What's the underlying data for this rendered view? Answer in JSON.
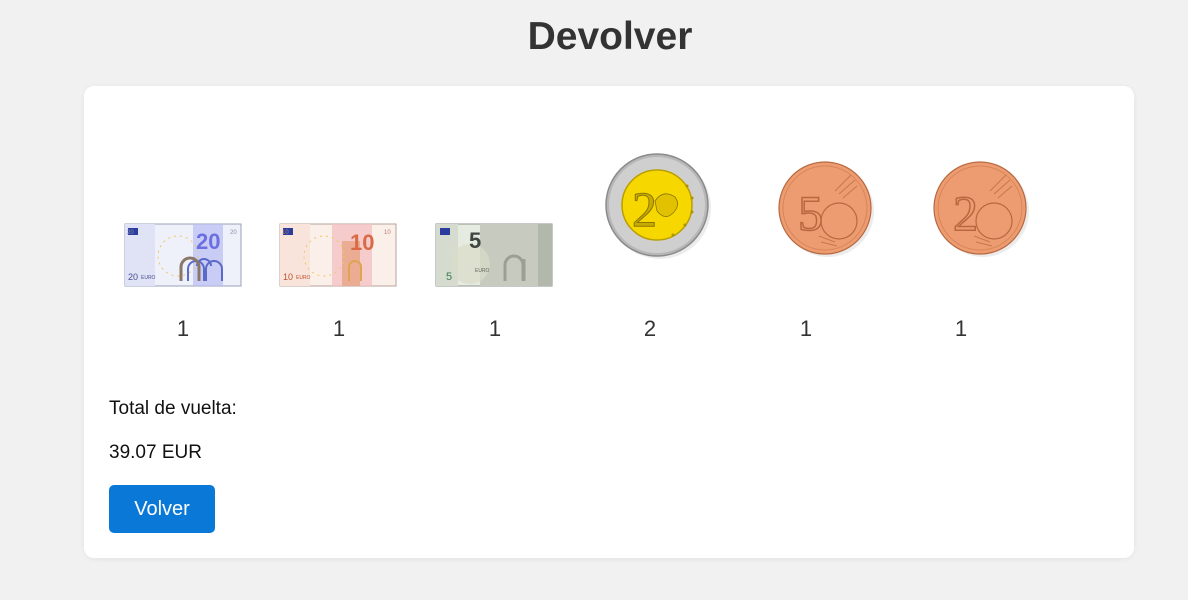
{
  "page": {
    "title": "Devolver"
  },
  "change": {
    "items": [
      {
        "kind": "banknote",
        "denomination": "20",
        "currency_label": "EURO",
        "count": "1",
        "icon": "20-euro-banknote-icon",
        "color": "#7d7fe8"
      },
      {
        "kind": "banknote",
        "denomination": "10",
        "currency_label": "EURO",
        "count": "1",
        "icon": "10-euro-banknote-icon",
        "color": "#e0704c"
      },
      {
        "kind": "banknote",
        "denomination": "5",
        "currency_label": "EURO",
        "count": "1",
        "icon": "5-euro-banknote-icon",
        "color": "#8a9a8c"
      },
      {
        "kind": "coin",
        "denomination": "2",
        "count": "2",
        "icon": "2-euro-coin-icon",
        "color": "#f5d400"
      },
      {
        "kind": "coin",
        "denomination": "5",
        "count": "1",
        "icon": "5-cent-coin-icon",
        "color": "#e9976a"
      },
      {
        "kind": "coin",
        "denomination": "2",
        "count": "1",
        "icon": "2-cent-coin-icon",
        "color": "#e9976a"
      }
    ]
  },
  "total": {
    "label": "Total de vuelta:",
    "value": "39.07 EUR"
  },
  "actions": {
    "back_label": "Volver"
  },
  "colors": {
    "background": "#f1f1f1",
    "card": "#ffffff",
    "button": "#0a78d6"
  }
}
